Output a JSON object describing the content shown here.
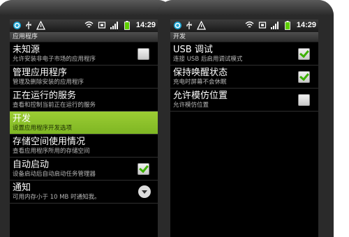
{
  "left_screen": {
    "status_time": "14:29",
    "title": "应用程序",
    "items": [
      {
        "title": "未知源",
        "subtitle": "允许安装非电子市场的应用程序",
        "control": "checkbox",
        "checked": false
      },
      {
        "title": "管理应用程序",
        "subtitle": "管理及删除安装的应用程序"
      },
      {
        "title": "正在运行的服务",
        "subtitle": "查看和控制当前正在运行的服务"
      },
      {
        "title": "开发",
        "subtitle": "设置应用程序开发选项",
        "highlighted": true
      },
      {
        "title": "存储空间使用情况",
        "subtitle": "查看应用程序所用的存储空间"
      },
      {
        "title": "自动启动",
        "subtitle": "设备启动后自动启动任务管理器",
        "control": "checkbox",
        "checked": true
      },
      {
        "title": "通知",
        "subtitle": "可用内存小于 10 MB 时通知我。",
        "control": "dropdown"
      }
    ]
  },
  "right_screen": {
    "status_time": "14:29",
    "title": "开发",
    "items": [
      {
        "title": "USB 调试",
        "subtitle": "连接 USB 后启用调试模式",
        "control": "checkbox",
        "checked": true
      },
      {
        "title": "保持唤醒状态",
        "subtitle": "充电时屏幕不会休眠",
        "control": "checkbox",
        "checked": true
      },
      {
        "title": "允许模仿位置",
        "subtitle": "允许模仿位置",
        "control": "checkbox",
        "checked": false
      }
    ]
  },
  "icons": [
    "sync-icon",
    "usb-icon",
    "warning-icon",
    "wifi-icon",
    "screenshot-icon",
    "signal-icon",
    "battery-icon"
  ],
  "colors": {
    "highlight": "#8bc12b",
    "checkmark": "#3db000"
  }
}
